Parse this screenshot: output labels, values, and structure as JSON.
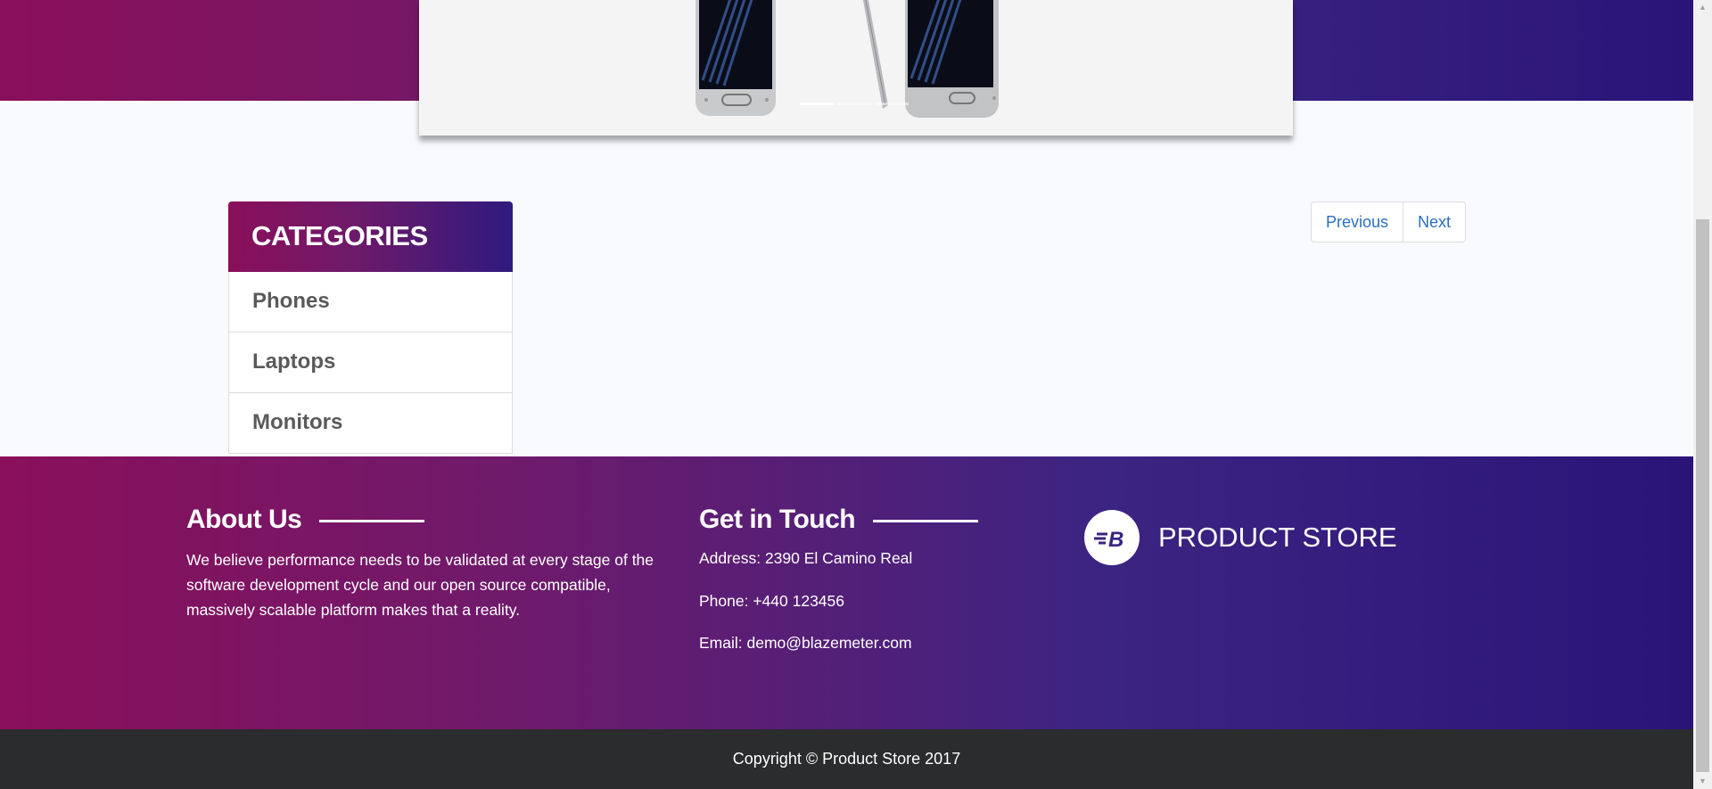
{
  "carousel": {
    "indicator_count": 3,
    "active_index": 0,
    "background_color": "#f4f4f4"
  },
  "categories": {
    "title": "CATEGORIES",
    "items": [
      {
        "label": "Phones"
      },
      {
        "label": "Laptops"
      },
      {
        "label": "Monitors"
      }
    ]
  },
  "pager": {
    "previous_label": "Previous",
    "next_label": "Next"
  },
  "footer": {
    "about": {
      "heading": "About Us",
      "text": "We believe performance needs to be validated at every stage of the software development cycle and our open source compatible, massively scalable platform makes that a reality."
    },
    "contact": {
      "heading": "Get in Touch",
      "address": "Address: 2390 El Camino Real",
      "phone": "Phone: +440 123456",
      "email": "Email: demo@blazemeter.com"
    },
    "brand": {
      "name": "PRODUCT STORE",
      "logo_icon": "blazemeter-logo-icon"
    },
    "copyright": "Copyright © Product Store 2017"
  },
  "colors": {
    "gradient_start": "#8a0f5a",
    "gradient_end": "#2a1478",
    "link_blue": "#2a6fc0",
    "copyright_bg": "#2b2c2d"
  }
}
